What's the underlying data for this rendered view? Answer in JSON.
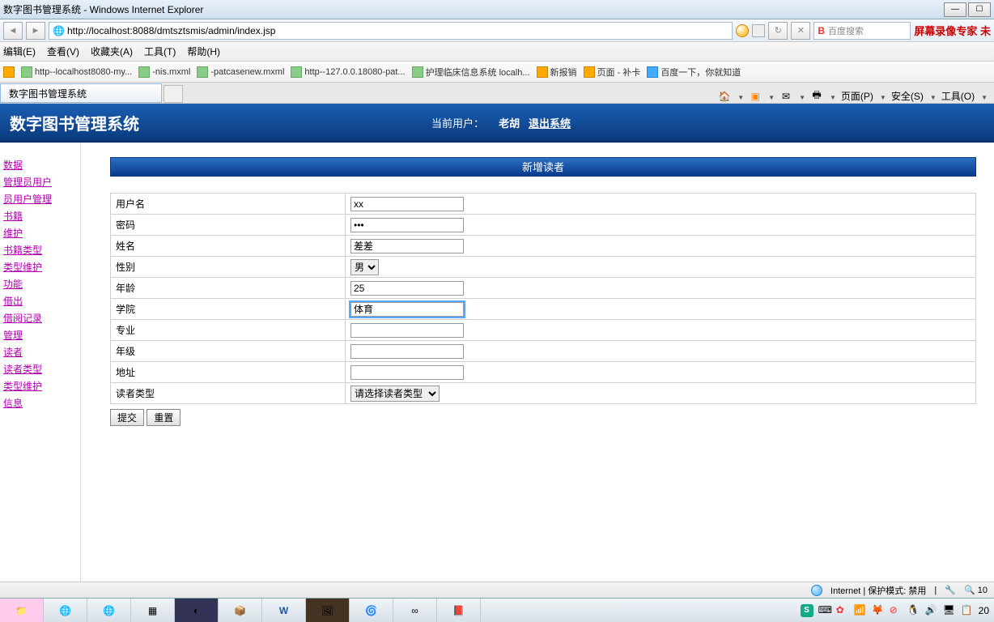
{
  "window": {
    "title": "数字图书管理系统 - Windows Internet Explorer",
    "min": "—",
    "max": "☐",
    "close": "✕"
  },
  "address": {
    "url": "http://localhost:8088/dmtsztsmis/admin/index.jsp",
    "search_placeholder": "百度搜索",
    "redtext": "屏幕录像专家 未"
  },
  "menu": {
    "edit": "编辑(E)",
    "view": "查看(V)",
    "favorites": "收藏夹(A)",
    "tools": "工具(T)",
    "help": "帮助(H)"
  },
  "favbar": {
    "items": [
      "http--localhost8080-my...",
      "-nis.mxml",
      "-patcasenew.mxml",
      "http--127.0.0.18080-pat...",
      "护理临床信息系统 localh...",
      "新报销",
      "页面 - 补卡",
      "百度一下，你就知道"
    ]
  },
  "tab": {
    "title": "数字图书管理系统"
  },
  "tabtools": {
    "page": "页面(P)",
    "safety": "安全(S)",
    "tools": "工具(O)"
  },
  "app": {
    "title": "数字图书管理系统",
    "current_user_label": "当前用户：",
    "current_user": "老胡",
    "logout": "退出系统"
  },
  "sidebar": {
    "items": [
      "数据",
      "管理员用户",
      "员用户管理",
      "书籍",
      "维护",
      "书籍类型",
      "类型维护",
      "功能",
      "借出",
      "借阅记录",
      "管理",
      "读者",
      "读者类型",
      "类型维护",
      "信息"
    ]
  },
  "page": {
    "title": "新增读者"
  },
  "form": {
    "username": {
      "label": "用户名",
      "value": "xx"
    },
    "password": {
      "label": "密码",
      "value": "•••"
    },
    "name": {
      "label": "姓名",
      "value": "差差"
    },
    "gender": {
      "label": "性别",
      "value": "男"
    },
    "age": {
      "label": "年龄",
      "value": "25"
    },
    "college": {
      "label": "学院",
      "value": "体育"
    },
    "major": {
      "label": "专业",
      "value": ""
    },
    "grade": {
      "label": "年级",
      "value": ""
    },
    "address": {
      "label": "地址",
      "value": ""
    },
    "readertype": {
      "label": "读者类型",
      "value": "请选择读者类型"
    },
    "submit": "提交",
    "reset": "重置"
  },
  "statusbar": {
    "zone": "Internet | 保护模式: 禁用",
    "zoom": "10"
  },
  "taskbar": {
    "time_right": "20",
    "sogou": "S"
  }
}
